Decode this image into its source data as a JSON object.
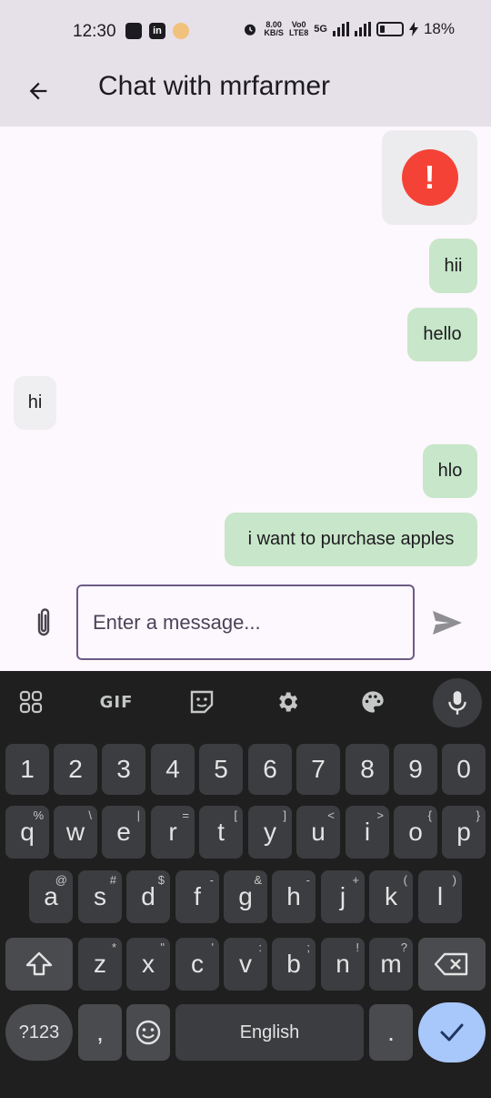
{
  "status_bar": {
    "time": "12:30",
    "speed_value": "8.00",
    "speed_unit": "KB/S",
    "vol_top": "Vo0",
    "vol_bottom": "LTE8",
    "network": "5G",
    "battery_percent": "18%"
  },
  "app_bar": {
    "title": "Chat with mrfarmer",
    "back_icon": "arrow-left-icon"
  },
  "messages": [
    {
      "type": "sent",
      "text": "hii"
    },
    {
      "type": "sent",
      "text": "hello"
    },
    {
      "type": "received",
      "text": "hi"
    },
    {
      "type": "sent",
      "text": "hlo"
    },
    {
      "type": "sent",
      "text": "i want to purchase apples"
    }
  ],
  "error_message": {
    "icon": "error-icon",
    "symbol": "!",
    "color": "#f44336"
  },
  "composer": {
    "placeholder": "Enter a message...",
    "value": "",
    "attach_icon": "paperclip-icon",
    "send_icon": "send-icon"
  },
  "keyboard": {
    "toolbar": {
      "apps_icon": "grid-icon",
      "gif_label": "GIF",
      "sticker_icon": "sticker-icon",
      "settings_icon": "gear-icon",
      "theme_icon": "palette-icon",
      "mic_icon": "mic-icon"
    },
    "number_row": [
      "1",
      "2",
      "3",
      "4",
      "5",
      "6",
      "7",
      "8",
      "9",
      "0"
    ],
    "row1": [
      {
        "key": "q",
        "alt": "%"
      },
      {
        "key": "w",
        "alt": "\\"
      },
      {
        "key": "e",
        "alt": "|"
      },
      {
        "key": "r",
        "alt": "="
      },
      {
        "key": "t",
        "alt": "["
      },
      {
        "key": "y",
        "alt": "]"
      },
      {
        "key": "u",
        "alt": "<"
      },
      {
        "key": "i",
        "alt": ">"
      },
      {
        "key": "o",
        "alt": "{"
      },
      {
        "key": "p",
        "alt": "}"
      }
    ],
    "row2": [
      {
        "key": "a",
        "alt": "@"
      },
      {
        "key": "s",
        "alt": "#"
      },
      {
        "key": "d",
        "alt": "$"
      },
      {
        "key": "f",
        "alt": "-"
      },
      {
        "key": "g",
        "alt": "&"
      },
      {
        "key": "h",
        "alt": "-"
      },
      {
        "key": "j",
        "alt": "+"
      },
      {
        "key": "k",
        "alt": "("
      },
      {
        "key": "l",
        "alt": ")"
      }
    ],
    "row3": [
      {
        "key": "z",
        "alt": "*"
      },
      {
        "key": "x",
        "alt": "\""
      },
      {
        "key": "c",
        "alt": "'"
      },
      {
        "key": "v",
        "alt": ":"
      },
      {
        "key": "b",
        "alt": ";"
      },
      {
        "key": "n",
        "alt": "!"
      },
      {
        "key": "m",
        "alt": "?"
      }
    ],
    "symbols_label": "?123",
    "comma": ",",
    "space_label": "English",
    "period": ".",
    "enter_color": "#a8c7fa"
  }
}
